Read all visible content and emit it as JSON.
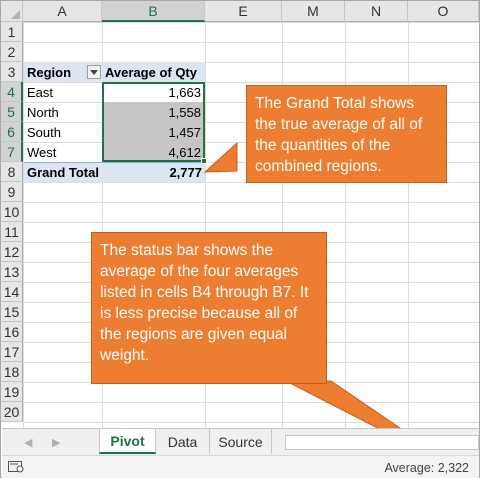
{
  "columns": [
    "A",
    "B",
    "E",
    "M",
    "N",
    "O"
  ],
  "selected_column": "B",
  "rows": [
    "1",
    "2",
    "3",
    "4",
    "5",
    "6",
    "7",
    "8",
    "9",
    "10",
    "11",
    "12",
    "13",
    "14",
    "15",
    "16",
    "17",
    "18",
    "19",
    "20"
  ],
  "selected_rows": [
    "4",
    "5",
    "6",
    "7"
  ],
  "pivot": {
    "header_region": "Region",
    "header_value": "Average of Qty",
    "data": [
      {
        "region": "East",
        "value": "1,663"
      },
      {
        "region": "North",
        "value": "1,558"
      },
      {
        "region": "South",
        "value": "1,457"
      },
      {
        "region": "West",
        "value": "4,612"
      }
    ],
    "total_label": "Grand Total",
    "total_value": "2,777"
  },
  "callouts": {
    "grand_total": "The Grand Total shows the true average of all of the quantities of the combined regions.",
    "status_bar": "The status bar shows the average of the four averages listed in cells B4 through B7. It is less precise because all of the regions are given equal weight."
  },
  "sheet_tabs": [
    {
      "label": "Pivot",
      "active": true
    },
    {
      "label": "Data",
      "active": false
    },
    {
      "label": "Source",
      "active": false
    }
  ],
  "status": {
    "average_text": "Average: 2,322"
  },
  "colors": {
    "excel_green": "#217346",
    "callout_orange": "#ed7d31",
    "pivot_band": "#dce6f2",
    "selection_gray": "#c6c6c6"
  }
}
